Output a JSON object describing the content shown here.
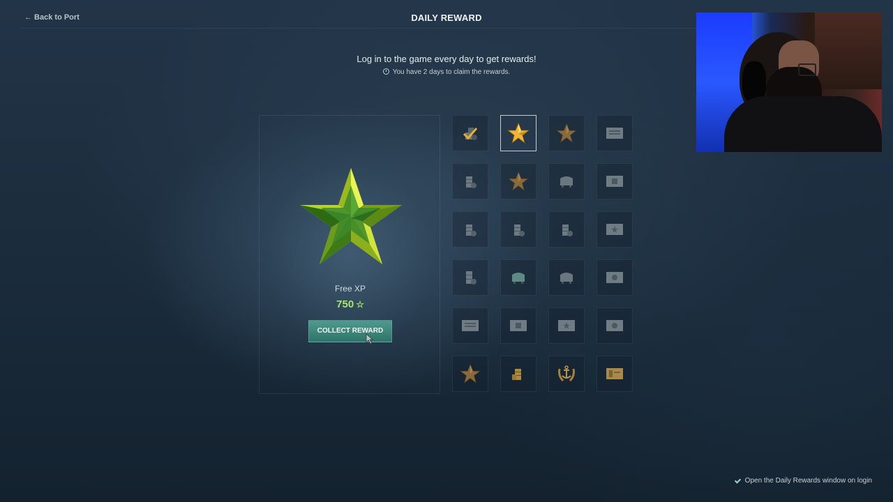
{
  "header": {
    "back_label": "← Back to Port",
    "title": "DAILY REWARD"
  },
  "intro": {
    "subtitle": "Log in to the game every day to get rewards!",
    "timer_note": "You have 2 days to claim the rewards."
  },
  "current_reward": {
    "name": "Free XP",
    "amount": "750",
    "amount_icon": "☆",
    "button_label": "COLLECT REWARD",
    "accent_color": "#a6e86a"
  },
  "reward_grid": {
    "rows": [
      [
        "claimed-check",
        "gold-star-current",
        "bronze-star",
        "silver-ticket"
      ],
      [
        "silver-coins",
        "bronze-star",
        "silver-container",
        "silver-ticket-badge"
      ],
      [
        "silver-coins",
        "silver-coins",
        "silver-coins",
        "silver-ticket-star"
      ],
      [
        "silver-coins",
        "silver-container",
        "silver-container",
        "silver-ticket-badge"
      ],
      [
        "silver-ticket",
        "silver-ticket-badge",
        "silver-ticket-star",
        "silver-ticket-badge"
      ],
      [
        "bronze-star",
        "gold-coins",
        "gold-anchor-wreath",
        "gold-ticket"
      ]
    ]
  },
  "footer": {
    "open_on_login_label": "Open the Daily Rewards window on login",
    "open_on_login_checked": true
  }
}
